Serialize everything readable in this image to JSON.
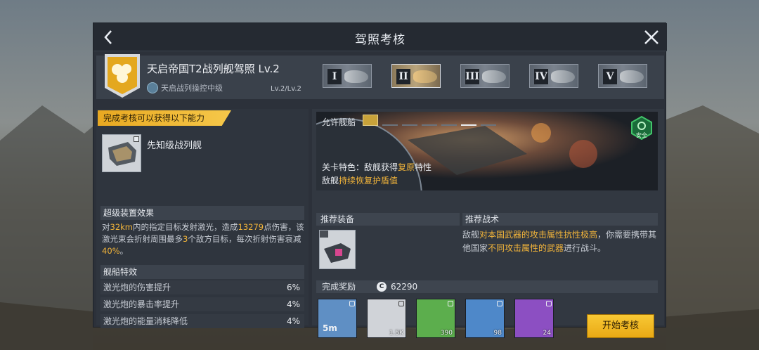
{
  "titlebar": {
    "title": "驾照考核"
  },
  "license": {
    "name": "天启帝国T2战列舰驾照 Lv.2",
    "sub_label": "天启战列操控中级",
    "level": "Lv.2/Lv.2",
    "tiers": [
      "I",
      "II",
      "III",
      "IV",
      "V"
    ],
    "active_tier": "II"
  },
  "left": {
    "banner": "完成考核可以获得以下能力",
    "ship_name": "先知级战列舰",
    "super_header": "超级装置效果",
    "super_desc": {
      "p1": "对",
      "v1": "32km",
      "p2": "内的指定目标发射激光，造成",
      "v2": "13279",
      "p3": "点伤害，该激光束会折射周围最多",
      "v3": "3",
      "p4": "个敌方目标，每次折射伤害衰减",
      "v4": "40%",
      "p5": "。"
    },
    "traits_header": "舰船特效",
    "traits": [
      {
        "label": "激光炮的伤害提升",
        "value": "6%"
      },
      {
        "label": "激光炮的暴击率提升",
        "value": "4%"
      },
      {
        "label": "激光炮的能量消耗降低",
        "value": "4%"
      }
    ]
  },
  "right": {
    "allowed_label": "允许舰船",
    "safe_label": "安全",
    "feature": {
      "line1_a": "关卡特色：敌舰获得",
      "line1_hl": "复原",
      "line1_b": "特性",
      "line2_a": "敌舰",
      "line2_hl": "持续恢复护盾值"
    },
    "recommend_header": "推荐装备",
    "tactic_header": "推荐战术",
    "tactic": {
      "t1": "敌舰",
      "h1": "对本国武器的攻击属性抗性极高",
      "t2": "，你需要携带其他国家",
      "h2": "不同攻击属性的武器",
      "t3": "进行战斗。"
    },
    "reward_header": "完成奖励",
    "coin_symbol": "C",
    "coin_amount": "62290",
    "rewards": [
      {
        "text": "5m",
        "count": "",
        "color": "#5f8fc4"
      },
      {
        "text": "",
        "count": "1.5K",
        "color": "#d0d3d8"
      },
      {
        "text": "",
        "count": "390",
        "color": "#5cae4d"
      },
      {
        "text": "",
        "count": "98",
        "color": "#4e88c9"
      },
      {
        "text": "",
        "count": "24",
        "color": "#8c4fc2"
      }
    ],
    "start_label": "开始考核"
  }
}
